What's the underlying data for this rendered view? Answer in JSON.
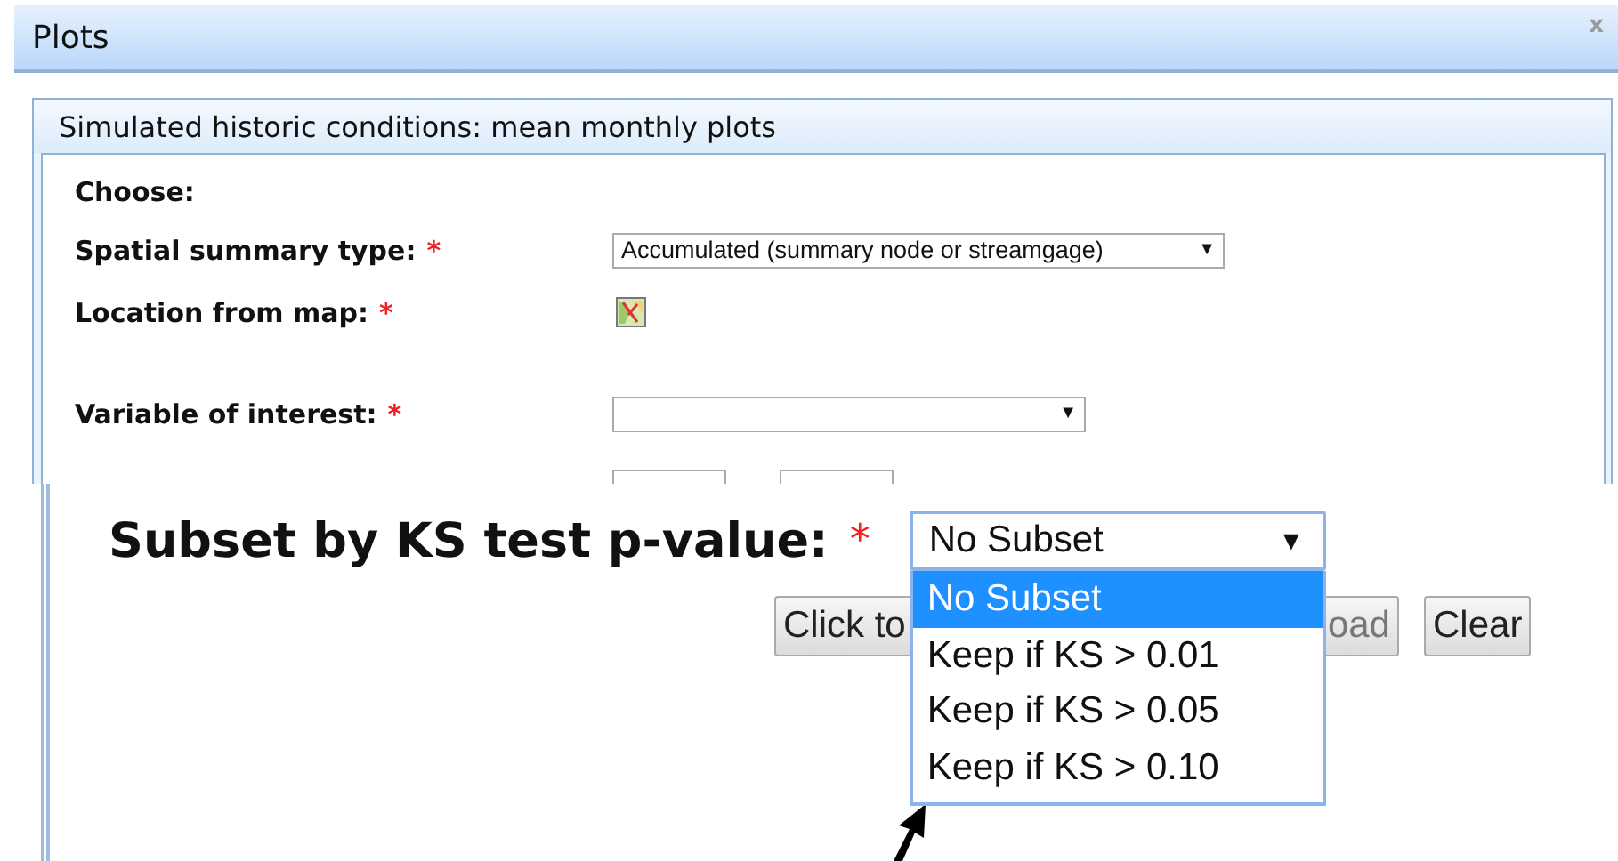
{
  "window": {
    "title": "Plots",
    "close": "x"
  },
  "panel": {
    "title": "Simulated historic conditions: mean monthly plots",
    "heading": "Choose:",
    "fields": [
      {
        "kind": "select",
        "label": "Spatial summary type:",
        "required_mark": "*",
        "value": "Accumulated (summary node or streamgage)",
        "caret": "▼"
      },
      {
        "kind": "map_button",
        "label": "Location from map:",
        "required_mark": "*"
      },
      {
        "kind": "spacer"
      },
      {
        "kind": "select",
        "label": "Variable of interest:",
        "required_mark": "*",
        "caret": "▼"
      },
      {
        "kind": "range"
      }
    ]
  },
  "zoom_inset": {
    "label": "Subset by KS test p-value:",
    "required_mark": "*",
    "select": {
      "value": "No Subset",
      "caret": "▼",
      "expanded": true,
      "options": [
        {
          "label": "No Subset",
          "selected": true
        },
        {
          "label": "Keep if KS > 0.01",
          "selected": false
        },
        {
          "label": "Keep if KS > 0.05",
          "selected": false
        },
        {
          "label": "Keep if KS > 0.10",
          "selected": false
        }
      ]
    },
    "buttons": [
      {
        "label": "Click to",
        "kind": "cut_right"
      },
      {
        "label": "oad",
        "kind": "cut_left"
      },
      {
        "label": "Clear",
        "kind": "full"
      }
    ]
  }
}
